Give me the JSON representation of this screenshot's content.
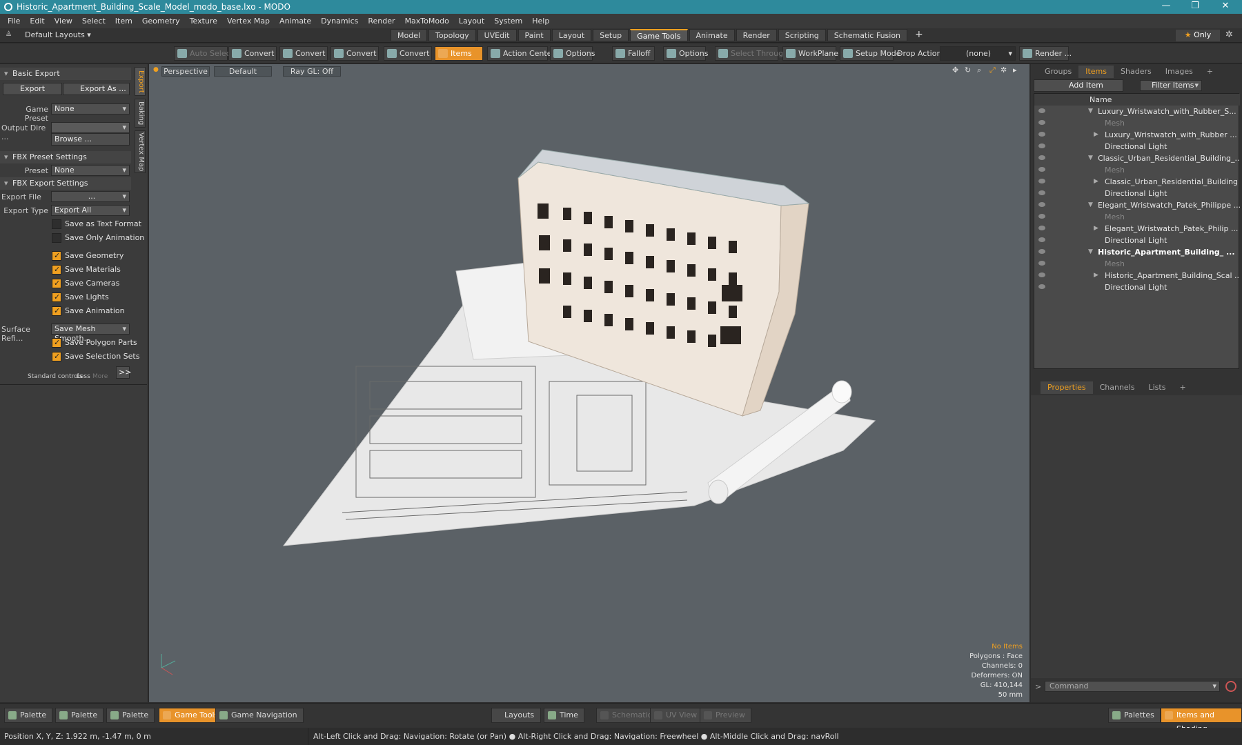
{
  "title": "Historic_Apartment_Building_Scale_Model_modo_base.lxo - MODO",
  "menu": [
    "File",
    "Edit",
    "View",
    "Select",
    "Item",
    "Geometry",
    "Texture",
    "Vertex Map",
    "Animate",
    "Dynamics",
    "Render",
    "MaxToModo",
    "Layout",
    "System",
    "Help"
  ],
  "layouts": {
    "default": "Default Layouts ▾",
    "tabs": [
      "Model",
      "Topology",
      "UVEdit",
      "Paint",
      "Layout",
      "Setup",
      "Game Tools",
      "Animate",
      "Render",
      "Scripting",
      "Schematic Fusion"
    ],
    "active": "Game Tools",
    "only": "Only"
  },
  "toolbar": {
    "auto_select": "Auto Select",
    "convert": "Convert",
    "items": "Items",
    "action_center": "Action Center",
    "options": "Options",
    "falloff": "Falloff",
    "select_through": "Select Through",
    "workplane": "WorkPlane",
    "setup_mode": "Setup Mode",
    "drop_action": "Drop Action",
    "none": "(none)",
    "render": "Render ..."
  },
  "left": {
    "basic_export": "Basic Export",
    "export": "Export",
    "export_as": "Export As ...",
    "game_preset_label": "Game Preset",
    "game_preset": "None",
    "output_dir_label": "Output Dire ...",
    "browse": "Browse ...",
    "fbx_preset_settings": "FBX Preset Settings",
    "preset_label": "Preset",
    "preset": "None",
    "fbx_export_settings": "FBX Export Settings",
    "export_file_label": "Export File",
    "export_file": "...",
    "export_type_label": "Export Type",
    "export_type": "Export All",
    "save_text": "Save as Text Format",
    "save_anim_only": "Save Only Animation",
    "save_geometry": "Save Geometry",
    "save_materials": "Save Materials",
    "save_cameras": "Save Cameras",
    "save_lights": "Save Lights",
    "save_animation": "Save Animation",
    "surface_label": "Surface Refi...",
    "surface_value": "Save Mesh Smooth...",
    "save_poly_parts": "Save Polygon Parts",
    "save_sel_sets": "Save Selection Sets",
    "std_controls": "Standard controls",
    "less": "Less",
    "more": "More",
    "vtabs": [
      "Export",
      "Baking",
      "Vertex Map"
    ]
  },
  "viewport": {
    "perspective": "Perspective",
    "default": "Default",
    "raygl": "Ray GL: Off",
    "no_items": "No Items",
    "polygons": "Polygons : Face",
    "channels": "Channels: 0",
    "deformers": "Deformers: ON",
    "gl": "GL: 410,144",
    "scale": "50 mm"
  },
  "right": {
    "tabs": [
      "Groups",
      "Items",
      "Shaders",
      "Images"
    ],
    "active_tab": "Items",
    "add_item": "Add Item",
    "filter_items": "Filter Items",
    "col_name": "Name",
    "items": [
      {
        "t": "Luxury_Wristwatch_with_Rubber_S...",
        "lvl": 0,
        "k": "group"
      },
      {
        "t": "Mesh",
        "lvl": 1,
        "k": "dim"
      },
      {
        "t": "Luxury_Wristwatch_with_Rubber ...",
        "lvl": 1,
        "k": "item"
      },
      {
        "t": "Directional Light",
        "lvl": 1,
        "k": "item"
      },
      {
        "t": "Classic_Urban_Residential_Building_...",
        "lvl": 0,
        "k": "group"
      },
      {
        "t": "Mesh",
        "lvl": 1,
        "k": "dim"
      },
      {
        "t": "Classic_Urban_Residential_Building",
        "lvl": 1,
        "k": "item"
      },
      {
        "t": "Directional Light",
        "lvl": 1,
        "k": "item"
      },
      {
        "t": "Elegant_Wristwatch_Patek_Philippe ...",
        "lvl": 0,
        "k": "group"
      },
      {
        "t": "Mesh",
        "lvl": 1,
        "k": "dim"
      },
      {
        "t": "Elegant_Wristwatch_Patek_Philip ...",
        "lvl": 1,
        "k": "item"
      },
      {
        "t": "Directional Light",
        "lvl": 1,
        "k": "item"
      },
      {
        "t": "Historic_Apartment_Building_ ...",
        "lvl": 0,
        "k": "bold"
      },
      {
        "t": "Mesh",
        "lvl": 1,
        "k": "dim"
      },
      {
        "t": "Historic_Apartment_Building_Scal ...",
        "lvl": 1,
        "k": "item"
      },
      {
        "t": "Directional Light",
        "lvl": 1,
        "k": "item"
      }
    ],
    "prop_tabs": [
      "Properties",
      "Channels",
      "Lists"
    ],
    "command": "Command"
  },
  "bottom": {
    "palette": "Palette",
    "game_tools": "Game Tools",
    "game_nav": "Game Navigation",
    "layouts": "Layouts",
    "time": "Time",
    "schematic": "Schematic",
    "uv_view": "UV View",
    "preview": "Preview",
    "palettes": "Palettes",
    "items_shading": "Items and Shading"
  },
  "status": {
    "position": "Position X, Y, Z:   1.922 m, -1.47 m, 0 m",
    "hint": "Alt-Left Click and Drag: Navigation: Rotate (or Pan) ● Alt-Right Click and Drag: Navigation: Freewheel ● Alt-Middle Click and Drag: navRoll"
  }
}
